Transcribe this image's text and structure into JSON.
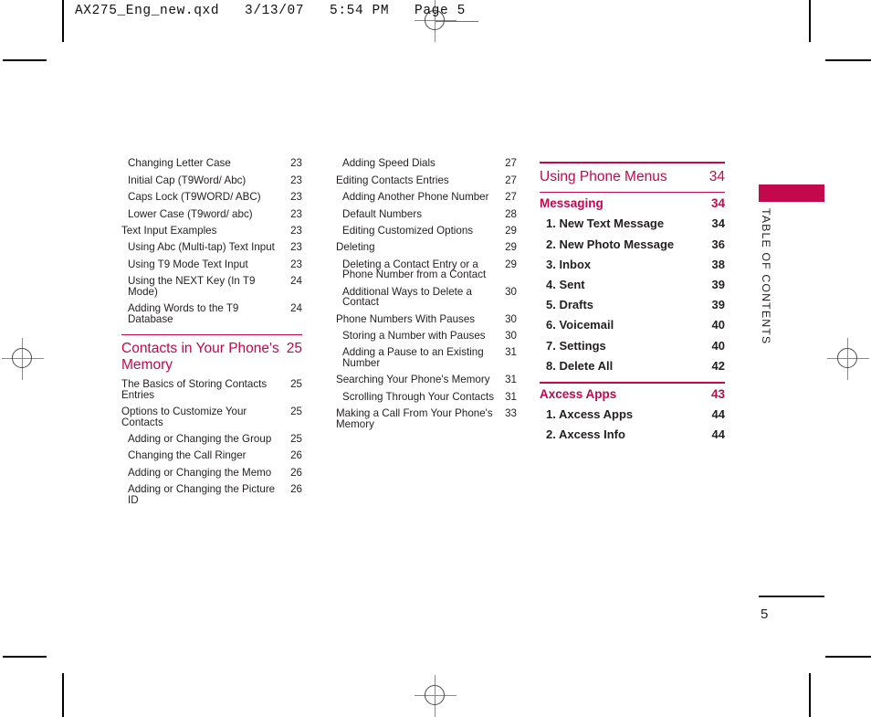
{
  "document": {
    "header_line": "AX275_Eng_new.qxd   3/13/07   5:54 PM   Page 5",
    "page_number": "5",
    "side_tab_label": "TABLE OF CONTENTS",
    "accent_color": "#C4084C",
    "text_color": "#231f20"
  },
  "columns": [
    {
      "id": "column-1",
      "entries": [
        {
          "type": "sub",
          "label": "Changing Letter Case",
          "page": "23"
        },
        {
          "type": "sub",
          "label": "Initial Cap (T9Word/ Abc)",
          "page": "23"
        },
        {
          "type": "sub",
          "label": "Caps Lock (T9WORD/ ABC)",
          "page": "23"
        },
        {
          "type": "sub",
          "label": "Lower Case (T9word/ abc)",
          "page": "23"
        },
        {
          "type": "item",
          "label": "Text Input Examples",
          "page": "23"
        },
        {
          "type": "sub",
          "label": "Using Abc (Multi-tap) Text Input",
          "page": "23"
        },
        {
          "type": "sub",
          "label": "Using T9 Mode Text Input",
          "page": "23"
        },
        {
          "type": "sub",
          "label": "Using the NEXT Key (In T9 Mode)",
          "page": "24"
        },
        {
          "type": "sub",
          "label": "Adding Words to the T9 Database",
          "page": "24"
        },
        {
          "type": "rule"
        },
        {
          "type": "section",
          "label": "Contacts in Your Phone's Memory",
          "page": "25"
        },
        {
          "type": "item",
          "label": "The Basics of Storing Contacts Entries",
          "page": "25"
        },
        {
          "type": "item",
          "label": "Options to Customize Your Contacts",
          "page": "25"
        },
        {
          "type": "sub",
          "label": "Adding or Changing the Group",
          "page": "25"
        },
        {
          "type": "sub",
          "label": "Changing the Call Ringer",
          "page": "26"
        },
        {
          "type": "sub",
          "label": "Adding or Changing the Memo",
          "page": "26"
        },
        {
          "type": "sub",
          "label": "Adding or Changing the Picture ID",
          "page": "26"
        }
      ]
    },
    {
      "id": "column-2",
      "entries": [
        {
          "type": "sub",
          "label": "Adding Speed Dials",
          "page": "27"
        },
        {
          "type": "item",
          "label": "Editing Contacts Entries",
          "page": "27"
        },
        {
          "type": "sub",
          "label": "Adding Another Phone Number",
          "page": "27"
        },
        {
          "type": "sub",
          "label": "Default Numbers",
          "page": "28"
        },
        {
          "type": "sub",
          "label": "Editing Customized Options",
          "page": "29"
        },
        {
          "type": "item",
          "label": "Deleting",
          "page": "29"
        },
        {
          "type": "sub",
          "label": "Deleting a Contact Entry or a Phone Number from a Contact",
          "page": "29"
        },
        {
          "type": "sub",
          "label": "Additional Ways to Delete a Contact",
          "page": "30"
        },
        {
          "type": "item",
          "label": "Phone Numbers With Pauses",
          "page": "30"
        },
        {
          "type": "sub",
          "label": "Storing a Number with Pauses",
          "page": "30"
        },
        {
          "type": "sub",
          "label": "Adding a Pause to an Existing Number",
          "page": "31"
        },
        {
          "type": "item",
          "label": "Searching Your Phone's Memory",
          "page": "31"
        },
        {
          "type": "sub",
          "label": "Scrolling Through Your Contacts",
          "page": "31"
        },
        {
          "type": "item",
          "label": "Making a Call From Your Phone's Memory",
          "page": "33"
        }
      ]
    },
    {
      "id": "column-3",
      "entries": [
        {
          "type": "rule"
        },
        {
          "type": "section",
          "label": "Using Phone Menus",
          "page": "34"
        },
        {
          "type": "rule"
        },
        {
          "type": "subsection",
          "label": "Messaging",
          "page": "34"
        },
        {
          "type": "numbered",
          "label": "1. New Text Message",
          "page": "34"
        },
        {
          "type": "numbered",
          "label": "2. New Photo Message",
          "page": "36"
        },
        {
          "type": "numbered",
          "label": "3. Inbox",
          "page": "38"
        },
        {
          "type": "numbered",
          "label": "4. Sent",
          "page": "39"
        },
        {
          "type": "numbered",
          "label": "5. Drafts",
          "page": "39"
        },
        {
          "type": "numbered",
          "label": "6. Voicemail",
          "page": "40"
        },
        {
          "type": "numbered",
          "label": "7. Settings",
          "page": "40"
        },
        {
          "type": "numbered",
          "label": "8. Delete All",
          "page": "42"
        },
        {
          "type": "rule"
        },
        {
          "type": "subsection",
          "label": "Axcess Apps",
          "page": "43"
        },
        {
          "type": "numbered",
          "label": "1. Axcess Apps",
          "page": "44"
        },
        {
          "type": "numbered",
          "label": "2. Axcess Info",
          "page": "44"
        }
      ]
    }
  ]
}
